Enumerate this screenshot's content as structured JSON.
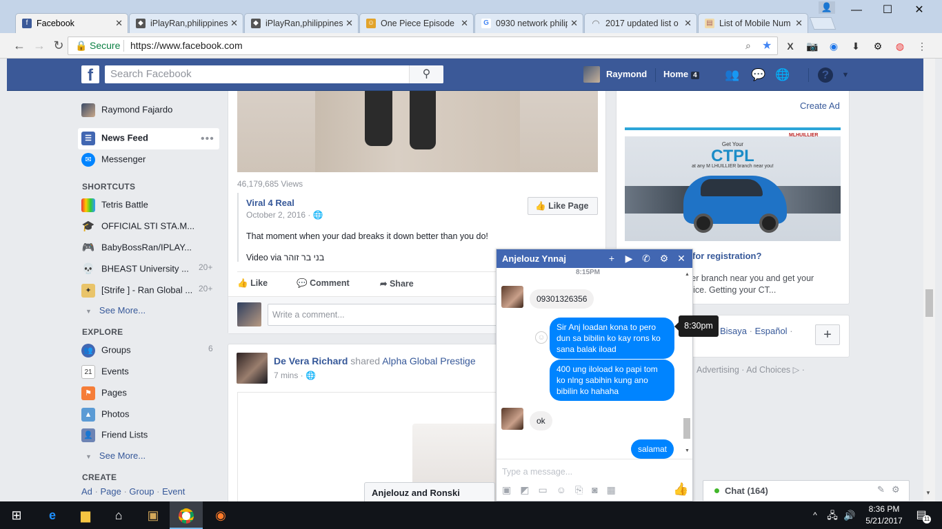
{
  "browser": {
    "tabs": [
      {
        "title": "Facebook",
        "icon": "facebook-icon"
      },
      {
        "title": "iPlayRan,philippines",
        "icon": "iplayran-icon"
      },
      {
        "title": "iPlayRan,philippines",
        "icon": "iplayran-icon"
      },
      {
        "title": "One Piece Episode",
        "icon": "one-piece-icon"
      },
      {
        "title": "0930 network philip",
        "icon": "google-icon"
      },
      {
        "title": "2017 updated list o",
        "icon": "loading-icon"
      },
      {
        "title": "List of Mobile Num",
        "icon": "document-icon"
      }
    ],
    "secure_label": "Secure",
    "url": "https://www.facebook.com"
  },
  "fb_header": {
    "search_placeholder": "Search Facebook",
    "user": "Raymond",
    "home": "Home",
    "home_count": "4"
  },
  "left_nav": {
    "profile": "Raymond Fajardo",
    "news_feed": "News Feed",
    "messenger": "Messenger",
    "shortcuts_title": "SHORTCUTS",
    "shortcuts": [
      {
        "label": "Tetris Battle",
        "count": ""
      },
      {
        "label": "OFFICIAL STI STA.M...",
        "count": ""
      },
      {
        "label": "BabyBossRan/IPLAY...",
        "count": ""
      },
      {
        "label": "BHEAST University ...",
        "count": "20+"
      },
      {
        "label": "[Strife ] - Ran Global ...",
        "count": "20+"
      }
    ],
    "see_more": "See More...",
    "explore_title": "EXPLORE",
    "explore": [
      {
        "label": "Groups",
        "count": "6"
      },
      {
        "label": "Events",
        "count": ""
      },
      {
        "label": "Pages",
        "count": ""
      },
      {
        "label": "Photos",
        "count": ""
      },
      {
        "label": "Friend Lists",
        "count": ""
      }
    ],
    "see_more_2": "See More...",
    "create_title": "CREATE",
    "create_links": [
      "Ad",
      "Page",
      "Group",
      "Event"
    ]
  },
  "post1": {
    "views": "46,179,685 Views",
    "page_name": "Viral 4 Real",
    "date": "October 2, 2016",
    "like_page": "Like Page",
    "text": "That moment when your dad breaks it down better than you do!",
    "video_via": "Video via בני בר זוהר",
    "like": "Like",
    "comment": "Comment",
    "share": "Share",
    "comment_placeholder": "Write a comment..."
  },
  "post2": {
    "author": "De Vera Richard",
    "shared": "shared",
    "target": "Alpha Global Prestige",
    "time": "7 mins"
  },
  "right_col": {
    "create_ad": "Create Ad",
    "ad_get_your": "Get Your",
    "ad_big": "CTPL",
    "ad_sub": "at any M LHUILLIER branch near you!",
    "ad_brand": "MLHUILLIER",
    "ad_title": "for registration?",
    "ad_body_1": "llier branch near you and get your",
    "ad_body_2": "price. Getting your CT...",
    "lang_bisaya": "Bisaya",
    "lang_espanol": "Español",
    "footer": "Advertising · Ad Choices",
    "chat_label": "Chat (164)"
  },
  "chat": {
    "name": "Anjelouz Ynnaj",
    "time_header": "8:15PM",
    "tooltip_time": "8:30pm",
    "messages": [
      {
        "from": "in",
        "text": "09301326356"
      },
      {
        "from": "out",
        "text": "Sir Anj loadan kona to pero dun sa bibilin ko kay rons ko sana balak iload"
      },
      {
        "from": "out",
        "text": "400 ung iloload ko papi tom ko nlng sabihin kung ano bibilin ko hahaha"
      },
      {
        "from": "in",
        "text": "ok"
      },
      {
        "from": "out",
        "text": "salamat"
      }
    ],
    "input_placeholder": "Type a message...",
    "minimized_tab": "Anjelouz and Ronski"
  },
  "taskbar": {
    "time": "8:36 PM",
    "date": "5/21/2017",
    "notif_count": "11"
  }
}
